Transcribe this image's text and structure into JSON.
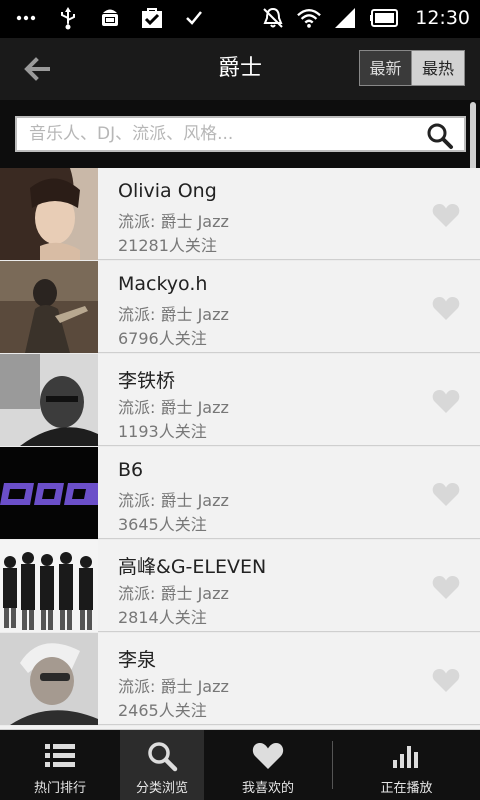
{
  "status_bar": {
    "time": "12:30",
    "icons": [
      "dots-icon",
      "usb-icon",
      "android-icon",
      "shopping-bag-check-icon",
      "check-icon",
      "alarm-off-icon",
      "wifi-icon",
      "signal-icon",
      "battery-icon"
    ]
  },
  "header": {
    "title": "爵士",
    "back_icon": "back-arrow-icon",
    "sort_newest": "最新",
    "sort_hottest": "最热"
  },
  "search": {
    "placeholder": "音乐人、DJ、流派、风格..."
  },
  "artists": [
    {
      "name": "Olivia Ong",
      "genre": "流派: 爵士 Jazz",
      "followers": "21281人关注"
    },
    {
      "name": "Mackyo.h",
      "genre": "流派: 爵士 Jazz",
      "followers": "6796人关注"
    },
    {
      "name": "李铁桥",
      "genre": "流派: 爵士 Jazz",
      "followers": "1193人关注"
    },
    {
      "name": "B6",
      "genre": "流派: 爵士 Jazz",
      "followers": "3645人关注"
    },
    {
      "name": "高峰&G-ELEVEN",
      "genre": "流派: 爵士 Jazz",
      "followers": "2814人关注"
    },
    {
      "name": "李泉",
      "genre": "流派: 爵士 Jazz",
      "followers": "2465人关注"
    }
  ],
  "bottom_nav": {
    "tabs": [
      {
        "label": "热门排行",
        "icon": "list-icon"
      },
      {
        "label": "分类浏览",
        "icon": "search-icon"
      },
      {
        "label": "我喜欢的",
        "icon": "heart-icon"
      },
      {
        "label": "正在播放",
        "icon": "equalizer-icon"
      }
    ],
    "active_index": 1
  },
  "colors": {
    "background": "#000000",
    "header": "#1a1a1a",
    "list_bg": "#f2f2f2",
    "text_primary": "#222222",
    "text_secondary": "#777777",
    "heart": "#d8d8d8"
  }
}
